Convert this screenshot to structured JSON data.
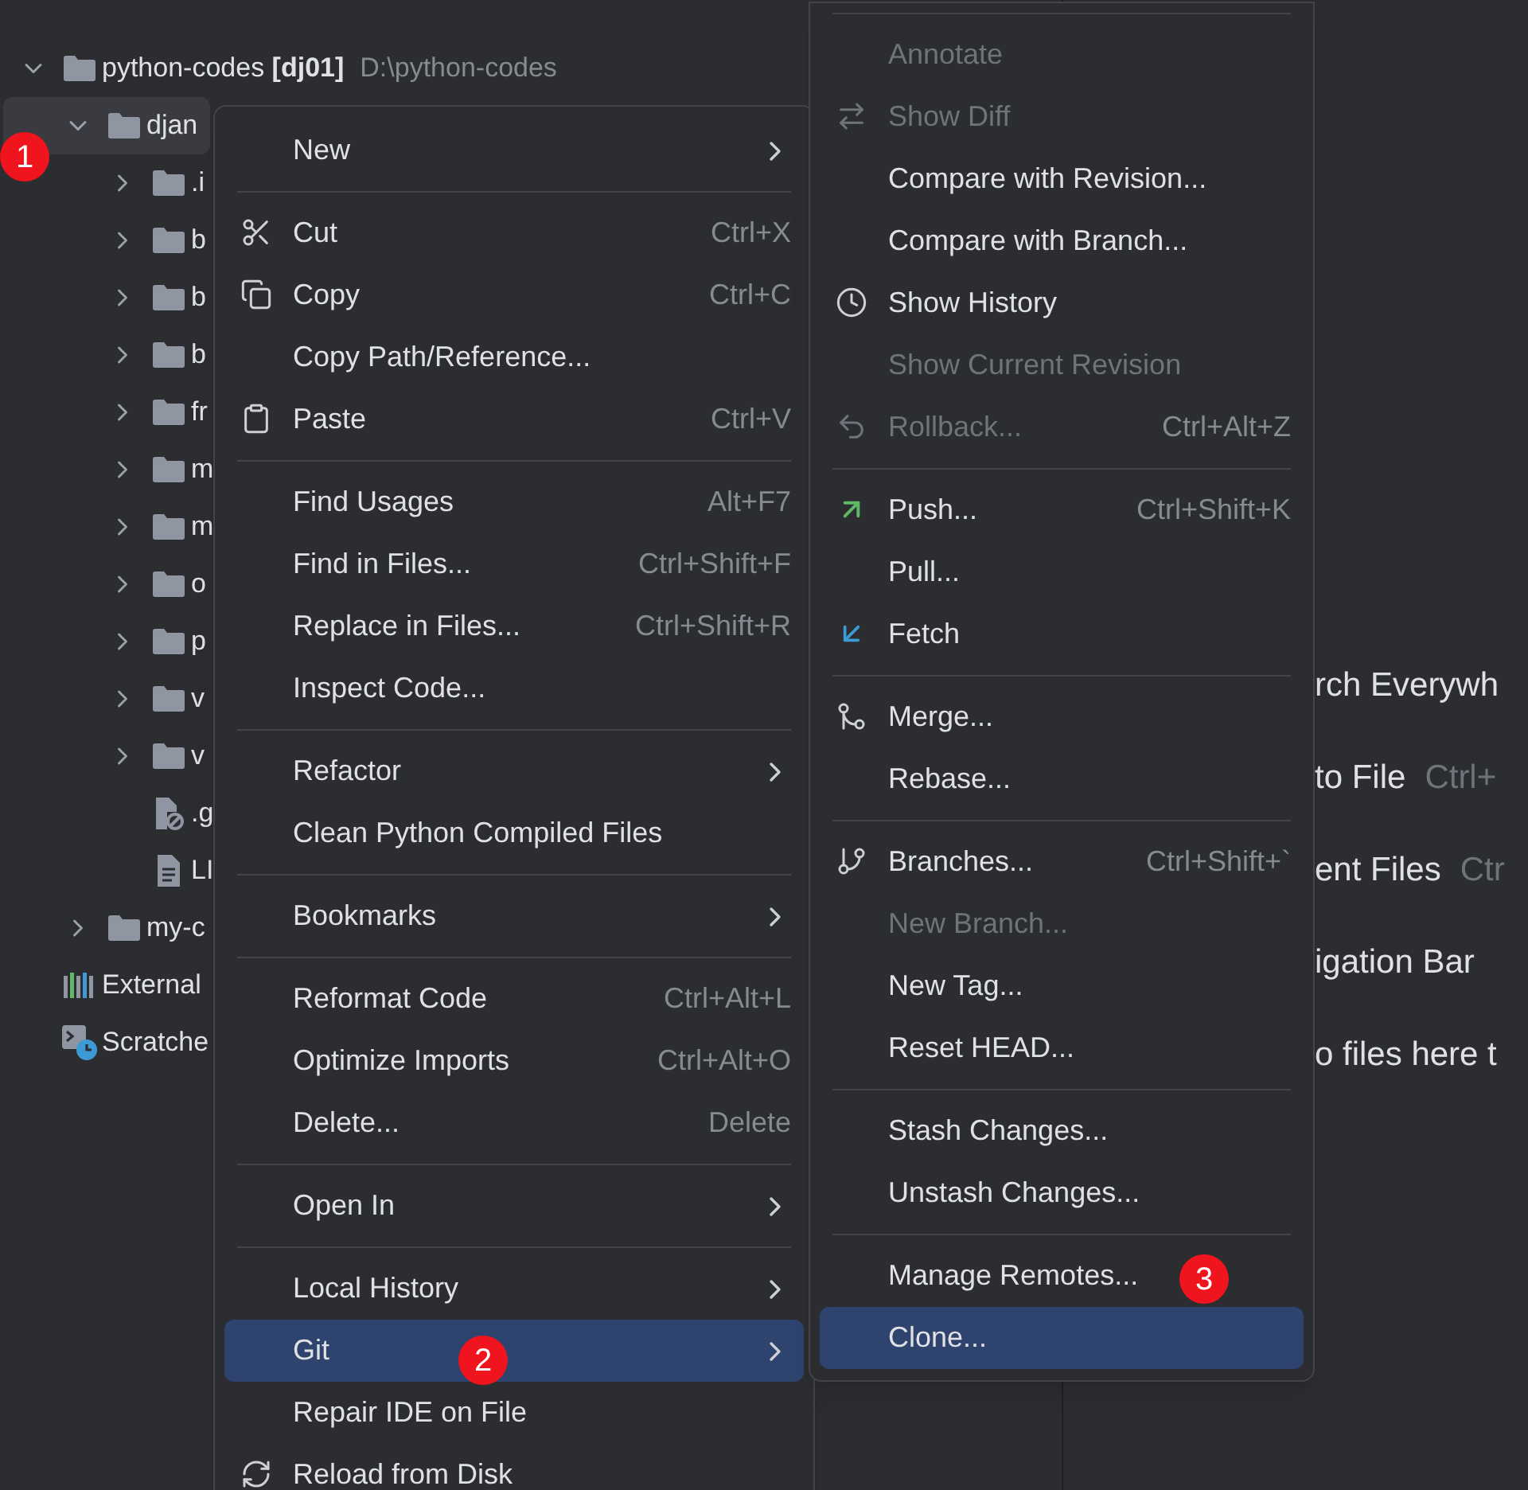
{
  "project_tree": {
    "items": [
      {
        "label": "python-codes **[dj01]**",
        "path": "D:\\python-codes",
        "kind": "folder",
        "expanded": true,
        "selected": false,
        "children": [
          {
            "label": "djan",
            "kind": "folder",
            "expanded": true,
            "selected": true,
            "children": [
              {
                "label": ".i",
                "kind": "folder",
                "expanded": false,
                "selected": false
              },
              {
                "label": "b",
                "kind": "folder",
                "expanded": false,
                "selected": false
              },
              {
                "label": "b",
                "kind": "folder",
                "expanded": false,
                "selected": false
              },
              {
                "label": "b",
                "kind": "folder",
                "expanded": false,
                "selected": false
              },
              {
                "label": "fr",
                "kind": "folder",
                "expanded": false,
                "selected": false
              },
              {
                "label": "m",
                "kind": "folder",
                "expanded": false,
                "selected": false
              },
              {
                "label": "m",
                "kind": "folder",
                "expanded": false,
                "selected": false
              },
              {
                "label": "o",
                "kind": "folder",
                "expanded": false,
                "selected": false
              },
              {
                "label": "p",
                "kind": "folder",
                "expanded": false,
                "selected": false
              },
              {
                "label": "v",
                "kind": "folder",
                "expanded": false,
                "selected": false
              },
              {
                "label": "v",
                "kind": "folder",
                "expanded": false,
                "selected": false
              },
              {
                "label": ".g",
                "kind": "ignore-file",
                "selected": false
              },
              {
                "label": "LI",
                "kind": "text-file",
                "selected": false
              }
            ]
          },
          {
            "label": "my-c",
            "kind": "folder",
            "expanded": false,
            "selected": false
          }
        ]
      },
      {
        "label": "External",
        "kind": "libraries",
        "selected": false
      },
      {
        "label": "Scratche",
        "kind": "scratches",
        "selected": false
      }
    ]
  },
  "context_menu": {
    "groups": [
      [
        {
          "label": "New",
          "submenu": true,
          "disabled": false,
          "selected": false
        }
      ],
      [
        {
          "label": "Cut",
          "shortcut": "Ctrl+X",
          "submenu": false,
          "disabled": false,
          "selected": false
        },
        {
          "label": "Copy",
          "shortcut": "Ctrl+C",
          "submenu": false,
          "disabled": false,
          "selected": false
        },
        {
          "label": "Copy Path/Reference...",
          "submenu": false,
          "disabled": false,
          "selected": false
        },
        {
          "label": "Paste",
          "shortcut": "Ctrl+V",
          "submenu": false,
          "disabled": false,
          "selected": false
        }
      ],
      [
        {
          "label": "Find Usages",
          "shortcut": "Alt+F7",
          "submenu": false,
          "disabled": false,
          "selected": false
        },
        {
          "label": "Find in Files...",
          "shortcut": "Ctrl+Shift+F",
          "submenu": false,
          "disabled": false,
          "selected": false
        },
        {
          "label": "Replace in Files...",
          "shortcut": "Ctrl+Shift+R",
          "submenu": false,
          "disabled": false,
          "selected": false
        },
        {
          "label": "Inspect Code...",
          "submenu": false,
          "disabled": false,
          "selected": false
        }
      ],
      [
        {
          "label": "Refactor",
          "submenu": true,
          "disabled": false,
          "selected": false
        },
        {
          "label": "Clean Python Compiled Files",
          "submenu": false,
          "disabled": false,
          "selected": false
        }
      ],
      [
        {
          "label": "Bookmarks",
          "submenu": true,
          "disabled": false,
          "selected": false
        }
      ],
      [
        {
          "label": "Reformat Code",
          "shortcut": "Ctrl+Alt+L",
          "submenu": false,
          "disabled": false,
          "selected": false
        },
        {
          "label": "Optimize Imports",
          "shortcut": "Ctrl+Alt+O",
          "submenu": false,
          "disabled": false,
          "selected": false
        },
        {
          "label": "Delete...",
          "shortcut": "Delete",
          "submenu": false,
          "disabled": false,
          "selected": false
        }
      ],
      [
        {
          "label": "Open In",
          "submenu": true,
          "disabled": false,
          "selected": false
        }
      ],
      [
        {
          "label": "Local History",
          "submenu": true,
          "disabled": false,
          "selected": false
        },
        {
          "label": "Git",
          "submenu": true,
          "disabled": false,
          "selected": true
        },
        {
          "label": "Repair IDE on File",
          "submenu": false,
          "disabled": false,
          "selected": false
        },
        {
          "label": "Reload from Disk",
          "submenu": false,
          "disabled": false,
          "selected": false
        }
      ]
    ]
  },
  "git_submenu": {
    "groups": [
      [
        {
          "label": "Annotate",
          "disabled": true,
          "selected": false
        },
        {
          "label": "Show Diff",
          "disabled": true,
          "selected": false
        },
        {
          "label": "Compare with Revision...",
          "disabled": false,
          "selected": false
        },
        {
          "label": "Compare with Branch...",
          "disabled": false,
          "selected": false
        },
        {
          "label": "Show History",
          "disabled": false,
          "selected": false
        },
        {
          "label": "Show Current Revision",
          "disabled": true,
          "selected": false
        },
        {
          "label": "Rollback...",
          "shortcut": "Ctrl+Alt+Z",
          "disabled": true,
          "selected": false
        }
      ],
      [
        {
          "label": "Push...",
          "shortcut": "Ctrl+Shift+K",
          "disabled": false,
          "selected": false
        },
        {
          "label": "Pull...",
          "disabled": false,
          "selected": false
        },
        {
          "label": "Fetch",
          "disabled": false,
          "selected": false
        }
      ],
      [
        {
          "label": "Merge...",
          "disabled": false,
          "selected": false
        },
        {
          "label": "Rebase...",
          "disabled": false,
          "selected": false
        }
      ],
      [
        {
          "label": "Branches...",
          "shortcut": "Ctrl+Shift+`",
          "disabled": false,
          "selected": false
        },
        {
          "label": "New Branch...",
          "disabled": true,
          "selected": false
        },
        {
          "label": "New Tag...",
          "disabled": false,
          "selected": false
        },
        {
          "label": "Reset HEAD...",
          "disabled": false,
          "selected": false
        }
      ],
      [
        {
          "label": "Stash Changes...",
          "disabled": false,
          "selected": false
        },
        {
          "label": "Unstash Changes...",
          "disabled": false,
          "selected": false
        }
      ],
      [
        {
          "label": "Manage Remotes...",
          "disabled": false,
          "selected": false
        },
        {
          "label": "Clone...",
          "disabled": false,
          "selected": true
        }
      ]
    ]
  },
  "editor_hints": [
    {
      "text": "rch Everywh"
    },
    {
      "text": "to File",
      "shortcut": "Ctrl+"
    },
    {
      "text": "ent Files",
      "shortcut": "Ctr"
    },
    {
      "text": "igation Bar"
    },
    {
      "text": "o files here t"
    }
  ],
  "annotations": [
    {
      "label": "1"
    },
    {
      "label": "2"
    },
    {
      "label": "3"
    }
  ]
}
